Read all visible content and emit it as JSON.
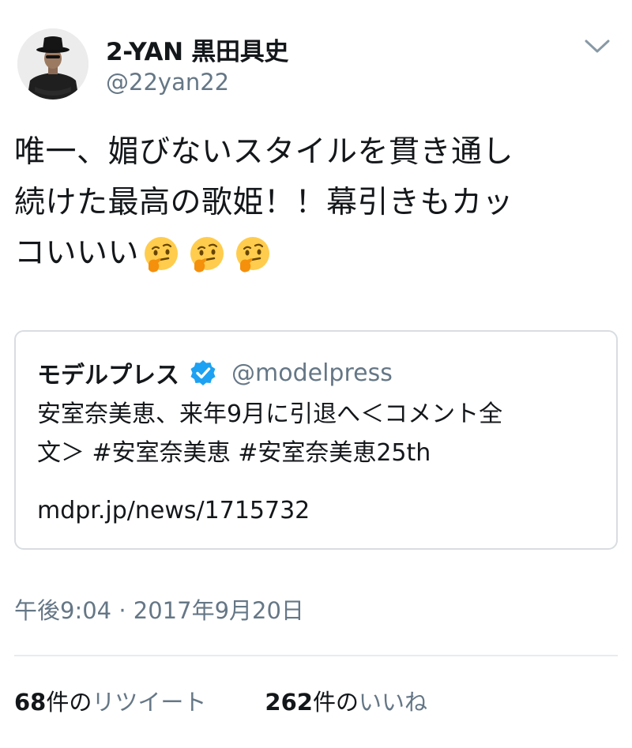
{
  "author": {
    "display_name": "2-YAN 黒田具史",
    "handle": "@22yan22",
    "avatar": "person-wearing-hat-avatar"
  },
  "menu_icon": "chevron-down-icon",
  "tweet": {
    "text_lines": [
      "唯一、媚びないスタイルを貫き通し",
      "続けた最高の歌姫！！幕引きもカッ",
      "コいいい"
    ],
    "emoji": [
      "thinking-face-emoji",
      "thinking-face-emoji",
      "thinking-face-emoji"
    ]
  },
  "quote": {
    "name": "モデルプレス",
    "verified_icon": "verified-badge-icon",
    "handle": "@modelpress",
    "text_lines": [
      "安室奈美恵、来年9月に引退へ＜コメント全",
      "文＞ #安室奈美恵 #安室奈美恵25th"
    ],
    "link": "mdpr.jp/news/1715732"
  },
  "timestamp": "午後9:04 · 2017年9月20日",
  "stats": {
    "retweets": {
      "count": "68",
      "unit": "件の",
      "label": "リツイート"
    },
    "likes": {
      "count": "262",
      "unit": "件の",
      "label": "いいね"
    }
  },
  "colors": {
    "text": "#14171a",
    "secondary": "#657786",
    "border": "#d8dde1",
    "verified": "#1da1f2",
    "emoji": "#ffcc4d"
  }
}
